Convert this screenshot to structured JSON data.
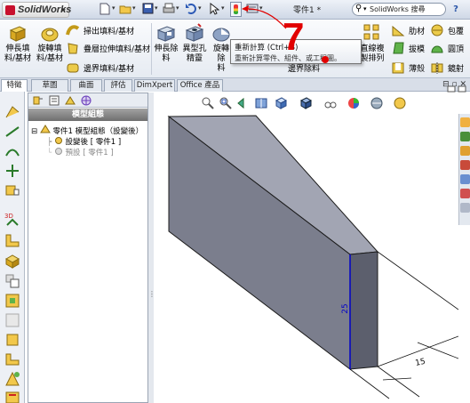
{
  "app": {
    "logo_text": "SolidWorks",
    "document_title": "零件1 *",
    "search_placeholder": "SolidWorks 搜尋",
    "help_label": "?"
  },
  "quick_access": {
    "icons": [
      "new-icon",
      "open-icon",
      "save-icon",
      "print-icon",
      "undo-icon",
      "select-icon",
      "rebuild-icon",
      "options-icon"
    ]
  },
  "ribbon": {
    "extrude_boss": "伸長填\n料/基材",
    "revolve_boss": "旋轉填\n料/基材",
    "sweep_boss": "掃出填料/基材",
    "loft_boss": "疊層拉伸填料/基材",
    "boundary_boss": "邊界填料/基材",
    "extrude_cut": "伸長除\n料",
    "hole_wizard": "異型孔\n精靈",
    "revolve_cut": "旋轉除\n料",
    "boundary_cut": "邊界除料",
    "linear_pattern": "直線複\n製排列",
    "rib": "肋材",
    "draft": "拔模",
    "shell": "薄殼",
    "wrap": "包覆",
    "dome": "圓頂",
    "mirror": "鏡射"
  },
  "tooltip": {
    "title": "重新計算 (Ctrl+B)",
    "description": "重新計算零件、組件、或工程圖。"
  },
  "step_annotation": "7",
  "tabs": [
    "特徵",
    "草圖",
    "曲面",
    "評估",
    "DimXpert",
    "Office 產品"
  ],
  "feature_manager": {
    "header": "模型組態",
    "root": "零件1 模型組態（設變後）",
    "items": [
      "設變後 [ 零件1 ]",
      "預設 [ 零件1 ]"
    ]
  },
  "model": {
    "dim_height": "25",
    "dim_width": "15"
  },
  "colors": {
    "step_red": "#e10000",
    "dimension_blue": "#0000c8",
    "face_front": "#7b7e8d",
    "face_top": "#a2a5b3",
    "face_side": "#5c5f6d"
  }
}
